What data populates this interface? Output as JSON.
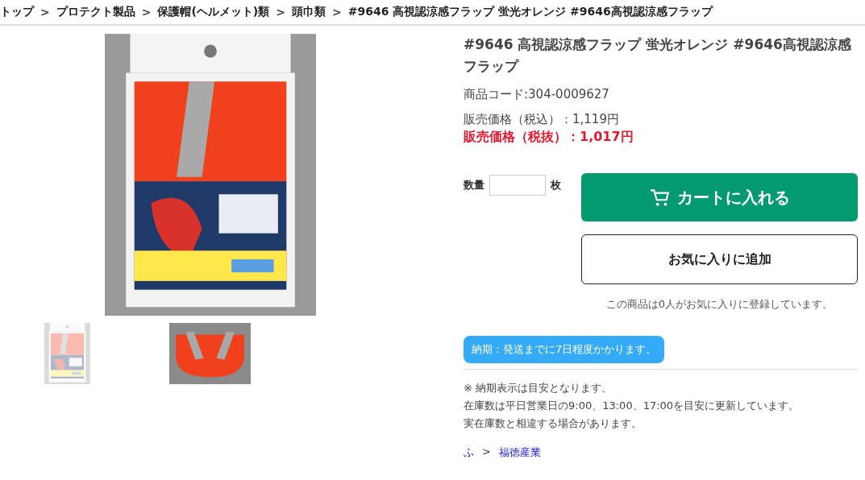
{
  "breadcrumb": [
    {
      "label": "トップ",
      "separator": ">"
    },
    {
      "label": "プロテクト製品",
      "separator": ">"
    },
    {
      "label": "保護帽(ヘルメット)類",
      "separator": ">"
    },
    {
      "label": "頭巾類",
      "separator": ">"
    },
    {
      "label": "#9646 高視認涼感フラップ 蛍光オレンジ #9646高視認涼感フラップ"
    }
  ],
  "gallery": {
    "main": {
      "kind": "picture"
    },
    "thumbnails": [
      {
        "kind": "picture",
        "selected": true
      },
      {
        "kind": "picture",
        "selected": false
      }
    ]
  },
  "product": {
    "title": "#9646 高視認涼感フラップ 蛍光オレンジ #9646高視認涼感フラップ",
    "code": "商品コード:304-0009627",
    "price_incl": "販売価格（税込）：1,119円",
    "price_excl": "販売価格（税抜）：1,017円"
  },
  "quantity": {
    "label": "数量",
    "unit": "枚"
  },
  "buttons": {
    "cart": "カートに入れる",
    "favorite": "お気に入りに追加"
  },
  "favorite_note": "この商品は0人がお気に入りに登録しています。",
  "delivery_badge": "納期：発送までに7日程度かかります。",
  "notes": [
    "※ 納期表示は目安となります。",
    "在庫数は平日営業日の9:00、13:00、17:00を目安に更新しています。",
    "実在庫数と相違する場合があります。"
  ],
  "maker_path": [
    {
      "label": "ふ",
      "separator": ">"
    },
    {
      "label": "福徳産業"
    }
  ]
}
